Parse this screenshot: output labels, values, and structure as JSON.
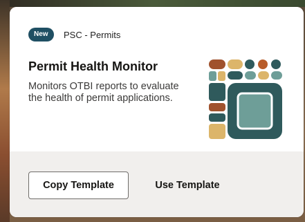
{
  "card": {
    "badge": "New",
    "category": "PSC - Permits",
    "title": "Permit Health Monitor",
    "description": "Monitors OTBI reports to evaluate the health of permit applications.",
    "illustration_icon": "mosaic-tiles-illustration",
    "actions": {
      "copy_template": "Copy Template",
      "use_template": "Use Template"
    }
  },
  "colors": {
    "badge_bg": "#1f4f63",
    "tile_dark_teal": "#2f5a5c",
    "tile_light_teal": "#6e9e98",
    "tile_sand": "#dcb56a",
    "tile_rust": "#b85c2a",
    "tile_brown": "#a0522d",
    "footer_bg": "#f1efed"
  }
}
